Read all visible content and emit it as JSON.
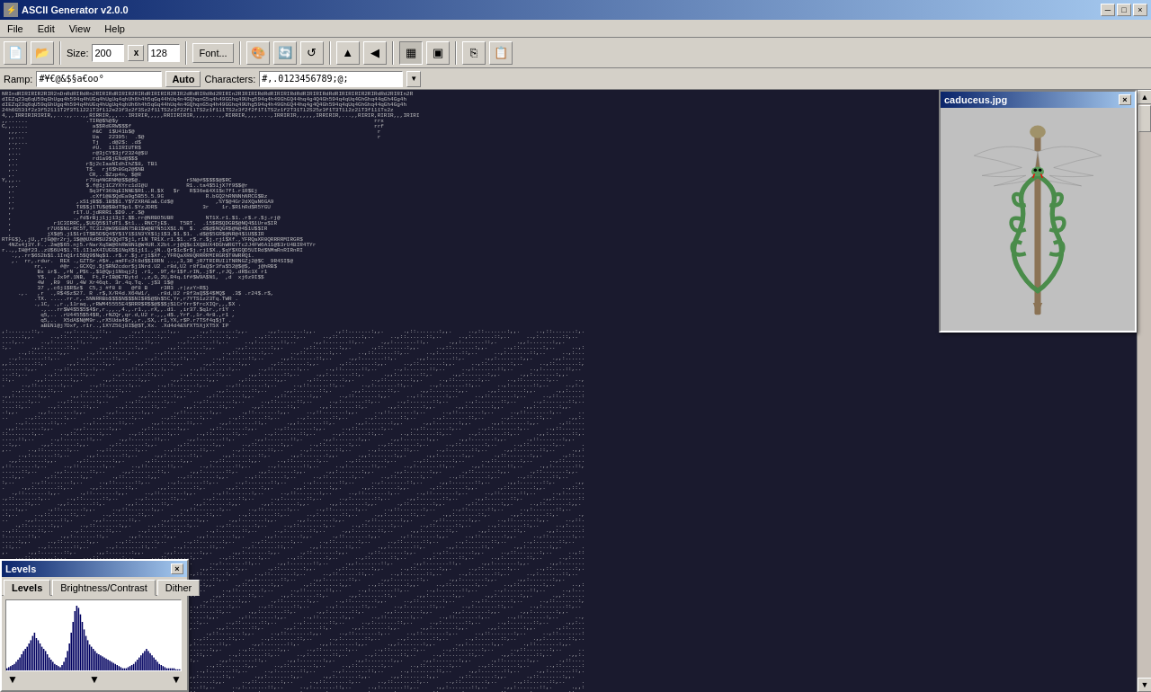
{
  "titleBar": {
    "title": "ASCII Generator v2.0.0",
    "minBtn": "─",
    "maxBtn": "□",
    "closeBtn": "×"
  },
  "menuBar": {
    "items": [
      "File",
      "Edit",
      "View",
      "Help"
    ]
  },
  "toolbar": {
    "sizeLabel": "Size:",
    "sizeValue": "200",
    "xLabel": "x",
    "heightValue": "128",
    "fontBtn": "Font...",
    "icons": [
      "new",
      "open",
      "save",
      "undo",
      "redo",
      "flip-h",
      "flip-v",
      "rotate-l",
      "rotate-r",
      "fit-width",
      "fit-height",
      "zoom-in",
      "zoom-out"
    ]
  },
  "rampBar": {
    "rampLabel": "Ramp:",
    "rampValue": "#¥€@&$§a€oo°",
    "autoLabel": "Auto",
    "charsLabel": "Characters:",
    "charsValue": "#,.0123456789;@;"
  },
  "levelsPanel": {
    "title": "Levels",
    "tabs": [
      "Levels",
      "Brightness/Contrast",
      "Dither"
    ],
    "activeTab": "Levels",
    "closeBtn": "×",
    "histogramData": [
      2,
      3,
      4,
      5,
      6,
      8,
      10,
      12,
      15,
      18,
      20,
      22,
      25,
      28,
      32,
      35,
      30,
      28,
      25,
      22,
      20,
      18,
      15,
      12,
      10,
      8,
      6,
      5,
      4,
      3,
      5,
      8,
      12,
      18,
      25,
      35,
      45,
      55,
      60,
      58,
      52,
      45,
      38,
      32,
      28,
      24,
      22,
      20,
      18,
      16,
      15,
      14,
      13,
      12,
      11,
      10,
      9,
      8,
      7,
      6,
      5,
      4,
      3,
      2,
      2,
      2,
      3,
      4,
      5,
      6,
      8,
      10,
      12,
      14,
      16,
      18,
      20,
      18,
      16,
      14,
      12,
      10,
      8,
      6,
      5,
      4,
      3,
      2,
      2,
      2,
      2,
      2,
      1,
      1,
      1,
      1
    ]
  },
  "previewPanel": {
    "title": "caduceus.jpg",
    "closeBtn": "×"
  },
  "asciiContent": "dense ascii art representation of a caduceus medical symbol"
}
